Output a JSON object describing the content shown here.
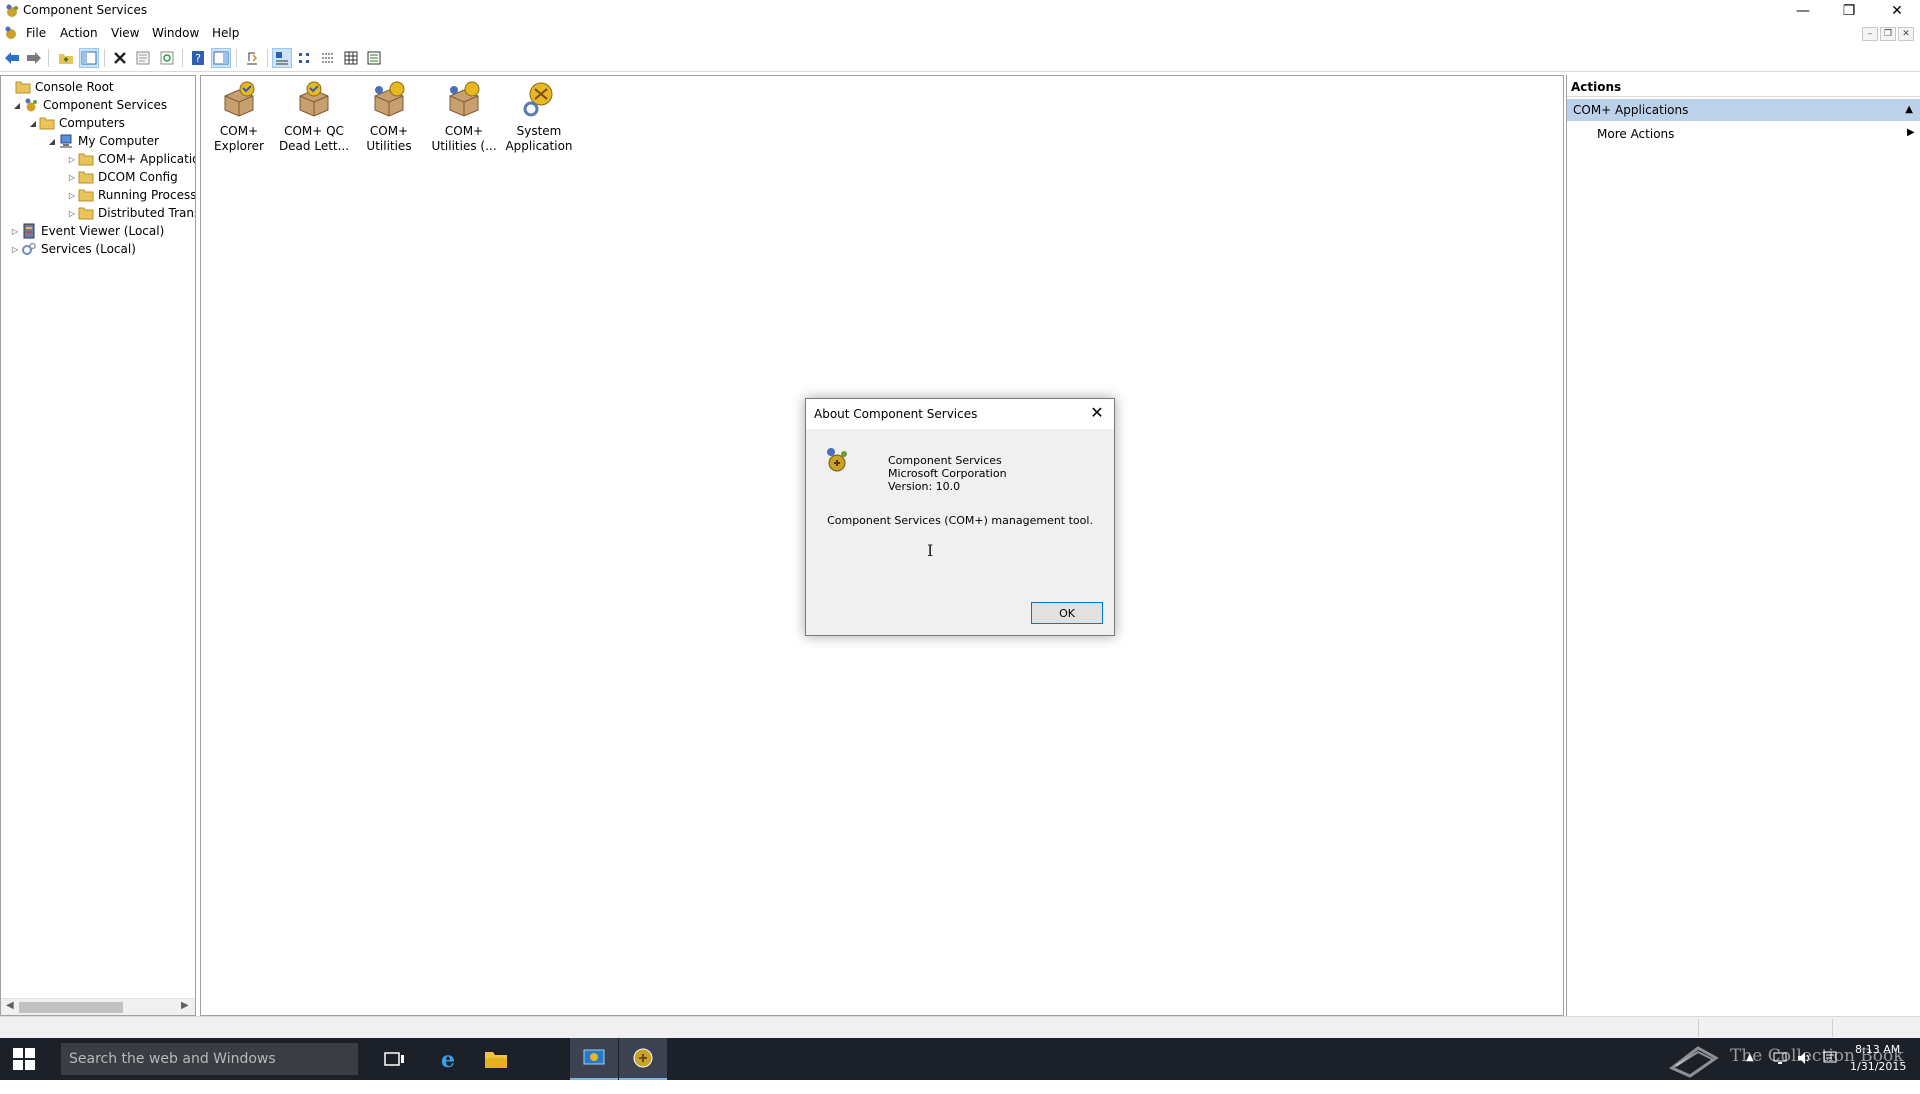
{
  "window": {
    "title": "Component Services",
    "controls": {
      "minimize": "—",
      "restore": "❐",
      "close": "✕"
    }
  },
  "menu": {
    "items": [
      "File",
      "Action",
      "View",
      "Window",
      "Help"
    ],
    "mdi_controls": [
      "–",
      "❐",
      "✕"
    ]
  },
  "toolbar": {
    "buttons": [
      "back",
      "forward",
      "up-folder",
      "show-hide-console-tree",
      "delete",
      "properties",
      "refresh",
      "help",
      "show-hide-action-pane",
      "export-list",
      "large-icons",
      "small-icons",
      "list",
      "detail",
      "status-view"
    ]
  },
  "tree": {
    "items": [
      {
        "label": "Console Root",
        "icon": "folder-icon",
        "expander": ""
      },
      {
        "label": "Component Services",
        "icon": "component-services-icon",
        "expander": "◢"
      },
      {
        "label": "Computers",
        "icon": "folder-icon",
        "expander": "◢"
      },
      {
        "label": "My Computer",
        "icon": "computer-icon",
        "expander": "◢"
      },
      {
        "label": "COM+ Applicatio",
        "icon": "folder-icon",
        "expander": "▷"
      },
      {
        "label": "DCOM Config",
        "icon": "folder-icon",
        "expander": "▷"
      },
      {
        "label": "Running Processe",
        "icon": "folder-icon",
        "expander": "▷"
      },
      {
        "label": "Distributed Transa",
        "icon": "folder-icon",
        "expander": "▷"
      },
      {
        "label": "Event Viewer (Local)",
        "icon": "event-viewer-icon",
        "expander": "▷"
      },
      {
        "label": "Services (Local)",
        "icon": "services-icon",
        "expander": "▷"
      }
    ]
  },
  "center": {
    "items": [
      {
        "line1": "COM+",
        "line2": "Explorer"
      },
      {
        "line1": "COM+ QC",
        "line2": "Dead Lett..."
      },
      {
        "line1": "COM+",
        "line2": "Utilities"
      },
      {
        "line1": "COM+",
        "line2": "Utilities (..."
      },
      {
        "line1": "System",
        "line2": "Application"
      }
    ]
  },
  "actions": {
    "header": "Actions",
    "section": "COM+ Applications",
    "more": "More Actions"
  },
  "dialog": {
    "title": "About Component Services",
    "product": "Component Services",
    "company": "Microsoft Corporation",
    "version": "Version: 10.0",
    "description": "Component Services (COM+) management tool.",
    "ok": "OK"
  },
  "taskbar": {
    "search_placeholder": "Search the web and Windows",
    "watermark": "The Collection Book",
    "time": "8:13 AM",
    "date": "1/31/2015"
  },
  "colors": {
    "accent": "#0078d7",
    "section_highlight": "#bcd2ea",
    "taskbar": "#1c2028"
  }
}
